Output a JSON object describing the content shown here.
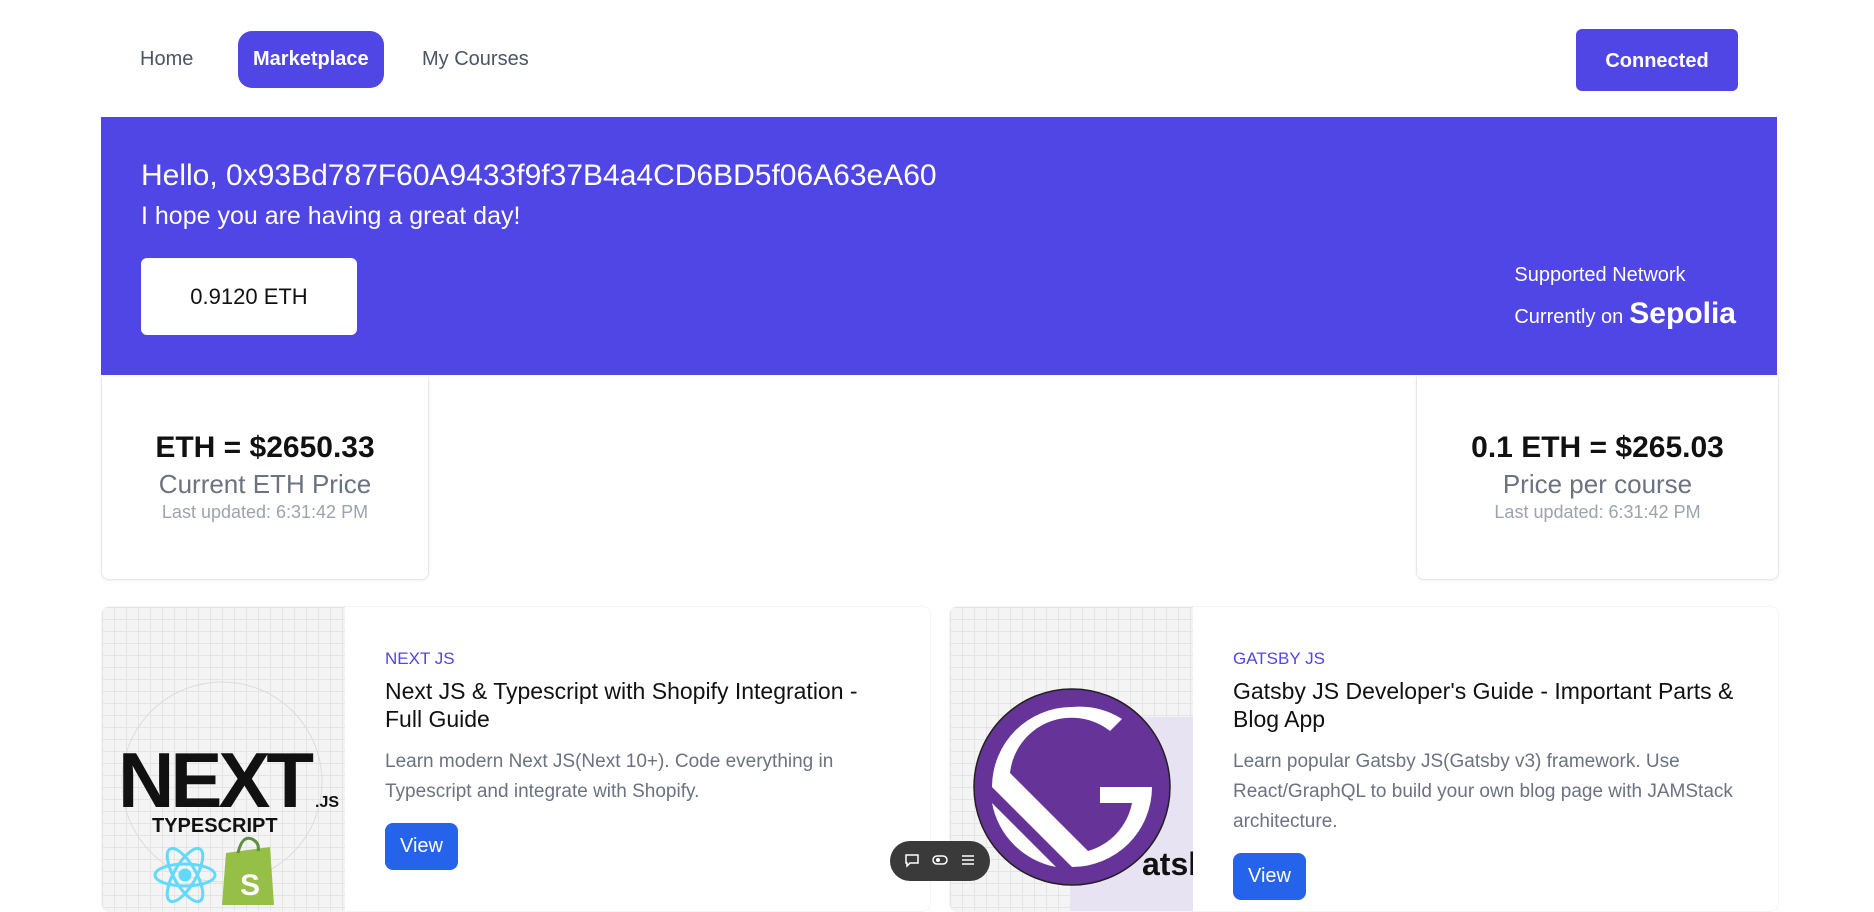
{
  "nav": {
    "items": [
      {
        "label": "Home"
      },
      {
        "label": "Marketplace",
        "active": true
      },
      {
        "label": "My Courses"
      }
    ],
    "connect_label": "Connected"
  },
  "hero": {
    "greeting": "Hello, 0x93Bd787F60A9433f9f37B4a4CD6BD5f06A63eA60",
    "subtitle": "I hope you are having a great day!",
    "balance": "0.9120 ETH",
    "network_label": "Supported Network",
    "currently_on": "Currently on",
    "network_name": "Sepolia"
  },
  "prices": [
    {
      "main": "ETH = $2650.33",
      "label": "Current ETH Price",
      "updated": "Last updated: 6:31:42 PM"
    },
    {
      "main": "0.1 ETH = $265.03",
      "label": "Price per course",
      "updated": "Last updated: 6:31:42 PM"
    }
  ],
  "courses": [
    {
      "category": "NEXT JS",
      "title": "Next JS & Typescript with Shopify Integration - Full Guide",
      "description": "Learn modern Next JS(Next 10+). Code everything in Typescript and integrate with Shopify.",
      "button": "View",
      "image_text": "NEXT",
      "image_subtext": ".JS",
      "image_caption": "TYPESCRIPT",
      "image_badge": "S"
    },
    {
      "category": "GATSBY JS",
      "title": "Gatsby JS Developer's Guide - Important Parts & Blog App",
      "description": "Learn popular Gatsby JS(Gatsby v3) framework. Use React/GraphQL to build your own blog page with JAMStack architecture.",
      "button": "View",
      "image_text": "atsb",
      "image_brand_color": "#663399"
    }
  ],
  "colors": {
    "primary": "#4f46e5",
    "button": "#2563eb"
  },
  "toolbar": {
    "icons": [
      "comment-icon",
      "toggle-icon",
      "menu-icon"
    ]
  }
}
